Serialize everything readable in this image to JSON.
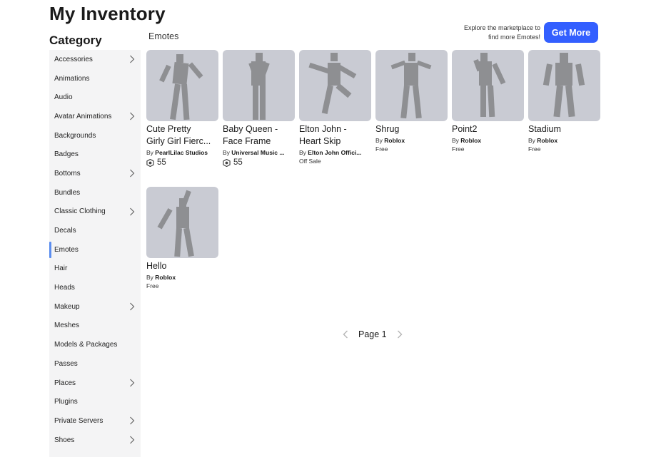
{
  "title": "My Inventory",
  "category_heading": "Category",
  "section_title": "Emotes",
  "promo": {
    "line1": "Explore the marketplace to",
    "line2": "find more Emotes!",
    "button_label": "Get More",
    "accent_color": "#335fff"
  },
  "categories": [
    {
      "label": "Accessories",
      "has_children": true
    },
    {
      "label": "Animations",
      "has_children": false
    },
    {
      "label": "Audio",
      "has_children": false
    },
    {
      "label": "Avatar Animations",
      "has_children": true
    },
    {
      "label": "Backgrounds",
      "has_children": false
    },
    {
      "label": "Badges",
      "has_children": false
    },
    {
      "label": "Bottoms",
      "has_children": true
    },
    {
      "label": "Bundles",
      "has_children": false
    },
    {
      "label": "Classic Clothing",
      "has_children": true
    },
    {
      "label": "Decals",
      "has_children": false
    },
    {
      "label": "Emotes",
      "has_children": false,
      "active": true
    },
    {
      "label": "Hair",
      "has_children": false
    },
    {
      "label": "Heads",
      "has_children": false
    },
    {
      "label": "Makeup",
      "has_children": true
    },
    {
      "label": "Meshes",
      "has_children": false
    },
    {
      "label": "Models & Packages",
      "has_children": false
    },
    {
      "label": "Passes",
      "has_children": false
    },
    {
      "label": "Places",
      "has_children": true
    },
    {
      "label": "Plugins",
      "has_children": false
    },
    {
      "label": "Private Servers",
      "has_children": true
    },
    {
      "label": "Shoes",
      "has_children": true
    }
  ],
  "items": [
    {
      "name": "Cute Pretty\nGirly Girl Fierc...",
      "by": "By",
      "creator": "PearlLilac Studios",
      "price": "55",
      "robux": true,
      "pose": "girly"
    },
    {
      "name": "Baby Queen -\nFace Frame",
      "by": "By",
      "creator": "Universal Music ...",
      "price": "55",
      "robux": true,
      "pose": "queen"
    },
    {
      "name": "Elton John -\nHeart Skip",
      "by": "By",
      "creator": "Elton John Offici...",
      "price": "Off Sale",
      "robux": false,
      "pose": "skip"
    },
    {
      "name": "Shrug",
      "by": "By",
      "creator": "Roblox",
      "price": "Free",
      "robux": false,
      "pose": "shrug"
    },
    {
      "name": "Point2",
      "by": "By",
      "creator": "Roblox",
      "price": "Free",
      "robux": false,
      "pose": "point"
    },
    {
      "name": "Stadium",
      "by": "By",
      "creator": "Roblox",
      "price": "Free",
      "robux": false,
      "pose": "stadium"
    },
    {
      "name": "Hello",
      "by": "By",
      "creator": "Roblox",
      "price": "Free",
      "robux": false,
      "pose": "hello"
    }
  ],
  "pagination": {
    "label": "Page 1"
  },
  "icons": {
    "chevron": "chevron-right-icon",
    "robux": "robux-icon",
    "prev": "chevron-left-icon",
    "next": "chevron-right-icon"
  }
}
